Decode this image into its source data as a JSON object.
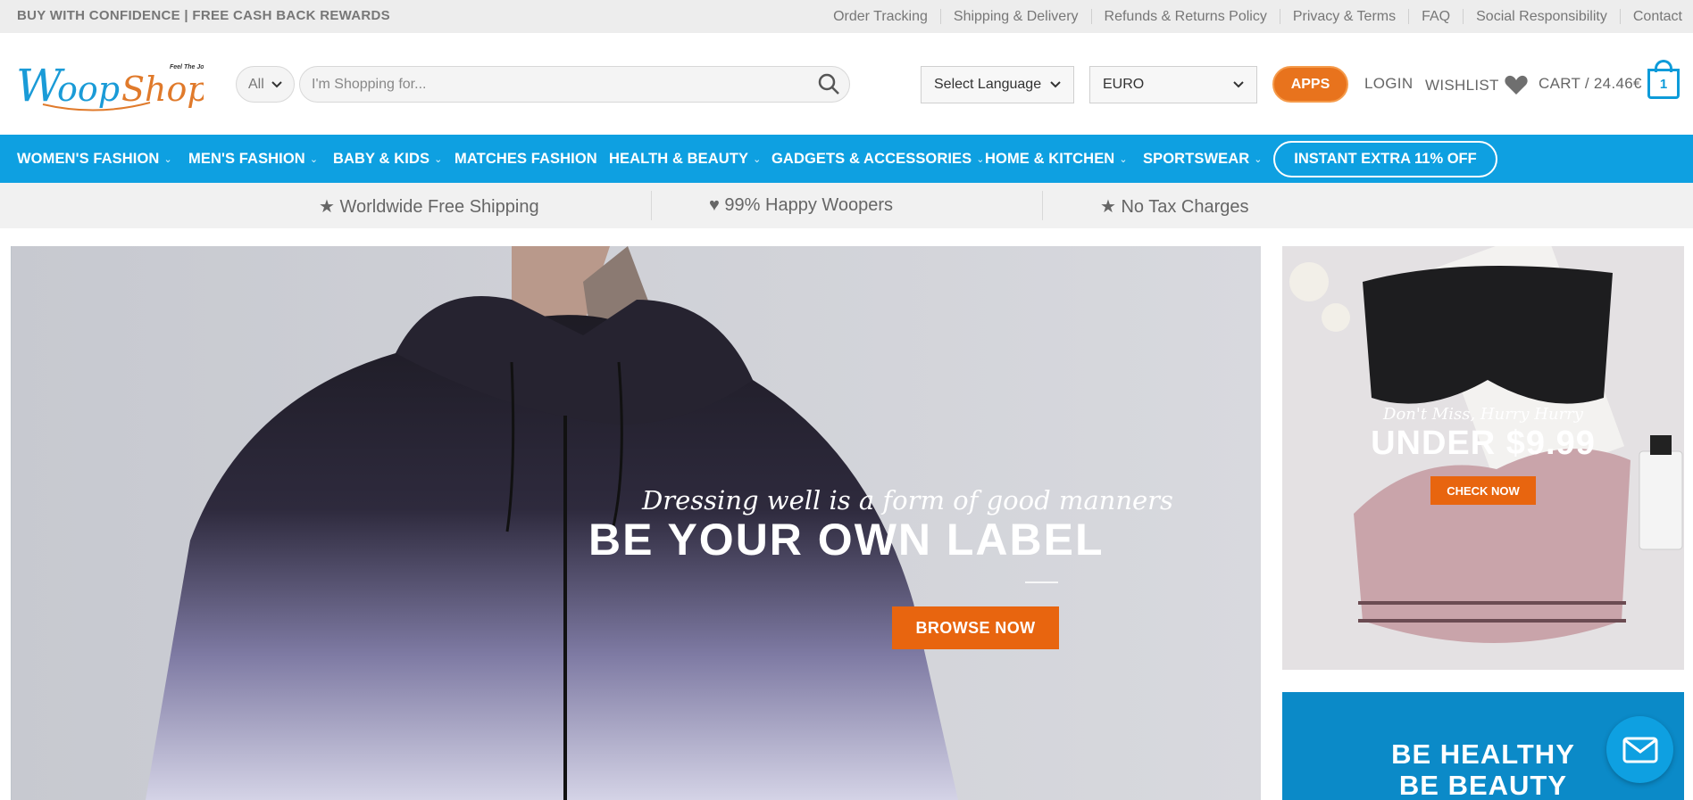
{
  "topbar": {
    "promo": "BUY WITH CONFIDENCE | FREE CASH BACK REWARDS",
    "links": [
      "Order Tracking",
      "Shipping & Delivery",
      "Refunds & Returns Policy",
      "Privacy & Terms",
      "FAQ",
      "Social Responsibility",
      "Contact"
    ]
  },
  "header": {
    "logo_text": "WoopShop",
    "logo_tagline": "Feel The Joy",
    "search_category": "All",
    "search_placeholder": "I'm Shopping for...",
    "language": "Select Language",
    "currency": "EURO",
    "apps_label": "APPS",
    "login_label": "LOGIN",
    "wishlist_label": "WISHLIST",
    "cart_label": "CART / 24.46€",
    "cart_count": "1"
  },
  "nav": {
    "items": [
      {
        "label": "WOMEN'S FASHION",
        "chevron": "chevron-down-icon"
      },
      {
        "label": "MEN'S FASHION",
        "chevron": "chevron-down-icon"
      },
      {
        "label": "BABY & KIDS",
        "chevron": "chevron-down-icon"
      },
      {
        "label": "MATCHES FASHION"
      },
      {
        "label": "HEALTH & BEAUTY",
        "chevron": "chevron-down-icon"
      },
      {
        "label": "GADGETS & ACCESSORIES",
        "chevron": "chevron-down-icon"
      },
      {
        "label": "HOME & KITCHEN",
        "chevron": "chevron-down-icon"
      },
      {
        "label": "SPORTSWEAR",
        "chevron": "chevron-down-icon"
      }
    ],
    "promo_button": "INSTANT EXTRA 11% OFF"
  },
  "benefits": [
    "★ Worldwide Free Shipping",
    "♥ 99% Happy Woopers",
    "★ No Tax Charges"
  ],
  "hero": {
    "script": "Dressing well is a form of good manners",
    "title": "BE YOUR OWN LABEL",
    "button": "BROWSE NOW"
  },
  "side_banner_1": {
    "script": "Don't Miss, Hurry Hurry",
    "title": "UNDER $9.99",
    "button": "CHECK NOW"
  },
  "side_banner_2": {
    "line1": "BE HEALTHY",
    "line2": "BE BEAUTY"
  },
  "colors": {
    "brand_blue": "#0ea0e1",
    "accent_orange": "#e8650f"
  }
}
